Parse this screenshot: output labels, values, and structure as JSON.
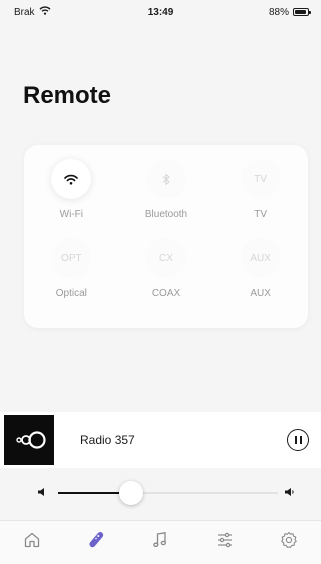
{
  "status_bar": {
    "carrier": "Brak",
    "time": "13:49",
    "battery": "88%",
    "battery_level": 0.88
  },
  "page": {
    "title": "Remote"
  },
  "sources": [
    {
      "key": "wifi",
      "icon": "wifi-icon",
      "label": "Wi-Fi",
      "active": true
    },
    {
      "key": "bluetooth",
      "icon": "bluetooth-icon",
      "label": "Bluetooth",
      "active": false
    },
    {
      "key": "tv",
      "icon_text": "TV",
      "label": "TV",
      "active": false
    },
    {
      "key": "optical",
      "icon_text": "OPT",
      "label": "Optical",
      "active": false
    },
    {
      "key": "coax",
      "icon_text": "CX",
      "label": "COAX",
      "active": false
    },
    {
      "key": "aux",
      "icon_text": "AUX",
      "label": "AUX",
      "active": false
    }
  ],
  "now_playing": {
    "station": "Radio 357",
    "state": "playing"
  },
  "volume": {
    "level": 0.33
  },
  "tabs": [
    {
      "key": "home",
      "icon": "home-icon",
      "active": false
    },
    {
      "key": "remote",
      "icon": "remote-icon",
      "active": true
    },
    {
      "key": "music",
      "icon": "music-note-icon",
      "active": false
    },
    {
      "key": "equalizer",
      "icon": "equalizer-icon",
      "active": false
    },
    {
      "key": "settings",
      "icon": "gear-icon",
      "active": false
    }
  ],
  "colors": {
    "accent": "#6b63c9",
    "text": "#1a1a1a",
    "muted": "#9a9a9a",
    "disabled": "#d6d6d6",
    "background": "#f5f5f6"
  }
}
